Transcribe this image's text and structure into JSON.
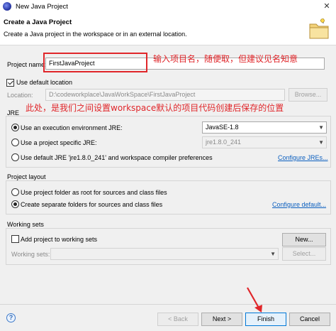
{
  "window": {
    "title": "New Java Project",
    "close_glyph": "✕"
  },
  "header": {
    "title": "Create a Java Project",
    "description": "Create a Java project in the workspace or in an external location."
  },
  "project_name": {
    "label": "Project name:",
    "value": "FirstJavaProject"
  },
  "use_default_location": {
    "label": "Use default location",
    "checked": true
  },
  "location": {
    "label": "Location:",
    "value": "D:\\codeworkplace\\JavaWorkSpace\\FirstJavaProject",
    "browse_label": "Browse..."
  },
  "jre": {
    "group_label": "JRE",
    "option_env": {
      "label": "Use an execution environment JRE:",
      "value": "JavaSE-1.8",
      "checked": true
    },
    "option_specific": {
      "label": "Use a project specific JRE:",
      "value": "jre1.8.0_241",
      "checked": false
    },
    "option_default": {
      "label": "Use default JRE 'jre1.8.0_241' and workspace compiler preferences",
      "link": "Configure JREs...",
      "checked": false
    }
  },
  "project_layout": {
    "group_label": "Project layout",
    "option_root": {
      "label": "Use project folder as root for sources and class files",
      "checked": false
    },
    "option_separate": {
      "label": "Create separate folders for sources and class files",
      "checked": true
    },
    "configure_link": "Configure default..."
  },
  "working_sets": {
    "group_label": "Working sets",
    "add_label": "Add project to working sets",
    "new_label": "New...",
    "sets_label": "Working sets:",
    "select_label": "Select..."
  },
  "footer": {
    "help_glyph": "?",
    "back_label": "< Back",
    "next_label": "Next >",
    "finish_label": "Finish",
    "cancel_label": "Cancel"
  },
  "annotations": {
    "name_note": "输入项目名，随便取，但建议见名知意",
    "location_note": "此处，是我们之间设置workspace默认的项目代码创建后保存的位置",
    "color": "#e0262a"
  }
}
